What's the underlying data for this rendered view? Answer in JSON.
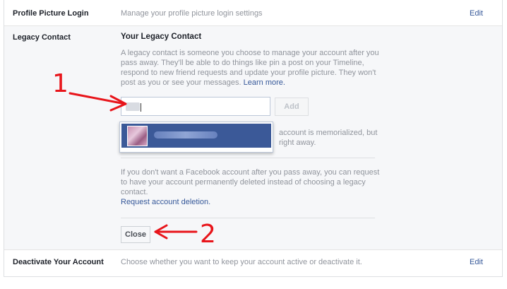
{
  "rows": {
    "profile_picture": {
      "label": "Profile Picture Login",
      "description": "Manage your profile picture login settings",
      "edit": "Edit"
    },
    "legacy": {
      "label": "Legacy Contact",
      "title": "Your Legacy Contact",
      "intro": "A legacy contact is someone you choose to manage your account after you pass away. They'll be able to do things like pin a post on your Timeline, respond to new friend requests and update your profile picture. They won't post as you or see your messages.",
      "learn_more": "Learn more.",
      "add_button": "Add",
      "hidden_text_line1": "account is memorialized, but",
      "hidden_text_line2": "right away.",
      "deletion_text": "If you don't want a Facebook account after you pass away, you can request to have your account permanently deleted instead of choosing a legacy contact.",
      "deletion_link": "Request account deletion.",
      "close_button": "Close"
    },
    "deactivate": {
      "label": "Deactivate Your Account",
      "description": "Choose whether you want to keep your account active or deactivate it.",
      "edit": "Edit"
    }
  },
  "annotations": {
    "step1": "1",
    "step2": "2",
    "color": "#e8151b"
  },
  "colors": {
    "link": "#365899",
    "highlight": "#3b5998"
  }
}
